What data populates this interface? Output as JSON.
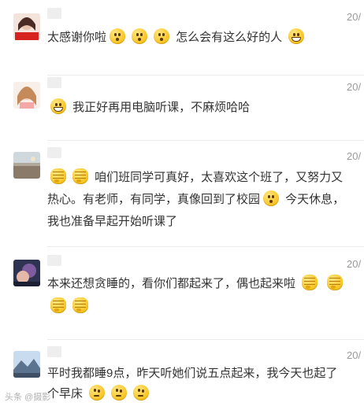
{
  "comments": [
    {
      "date": "20/",
      "avatar": "avatar-1",
      "lines": [
        [
          {
            "type": "text",
            "text": "太感谢你啦"
          },
          {
            "type": "emoji",
            "icon": "kiss-emoji-icon"
          },
          {
            "type": "emoji",
            "icon": "kiss-emoji-icon"
          },
          {
            "type": "emoji",
            "icon": "kiss-emoji-icon"
          },
          {
            "type": "text",
            "text": " 怎么会有这么好的人 "
          },
          {
            "type": "emoji",
            "icon": "grin-emoji-icon"
          }
        ]
      ]
    },
    {
      "date": "20/",
      "avatar": "avatar-2",
      "lines": [
        [
          {
            "type": "emoji",
            "icon": "grin-emoji-icon"
          },
          {
            "type": "text",
            "text": " 我正好再用电脑听课，不麻烦哈哈"
          }
        ]
      ]
    },
    {
      "date": "20/",
      "avatar": "avatar-3",
      "lines": [
        [
          {
            "type": "emoji",
            "icon": "fist-emoji-icon"
          },
          {
            "type": "emoji",
            "icon": "fist-emoji-icon"
          },
          {
            "type": "text",
            "text": " 咱们班同学可真好，太喜欢这个班了，又努力又"
          }
        ],
        [
          {
            "type": "text",
            "text": "热心。有老师，有同学，真像回到了校园"
          },
          {
            "type": "emoji",
            "icon": "kiss-emoji-icon"
          },
          {
            "type": "text",
            "text": " 今天休息，"
          }
        ],
        [
          {
            "type": "text",
            "text": "我也准备早起开始听课了"
          }
        ]
      ]
    },
    {
      "date": "20/",
      "avatar": "avatar-4",
      "lines": [
        [
          {
            "type": "text",
            "text": "本来还想贪睡的，看你们都起来了，偶也起来啦 "
          },
          {
            "type": "emoji",
            "icon": "fist-emoji-icon"
          },
          {
            "type": "text",
            "text": " "
          },
          {
            "type": "emoji",
            "icon": "fist-emoji-icon"
          }
        ],
        [
          {
            "type": "emoji",
            "icon": "fist-emoji-icon"
          },
          {
            "type": "emoji",
            "icon": "fist-emoji-icon"
          }
        ]
      ]
    },
    {
      "date": "20/",
      "avatar": "avatar-5",
      "lines": [
        [
          {
            "type": "text",
            "text": "平时我都睡9点，昨天听她们说五点起来，我今天也起了"
          }
        ],
        [
          {
            "type": "text",
            "text": "个早床 "
          },
          {
            "type": "emoji",
            "icon": "think-emoji-icon"
          },
          {
            "type": "emoji",
            "icon": "think-emoji-icon"
          },
          {
            "type": "emoji",
            "icon": "think-emoji-icon"
          }
        ]
      ]
    }
  ],
  "watermark": "头条 @摄影"
}
